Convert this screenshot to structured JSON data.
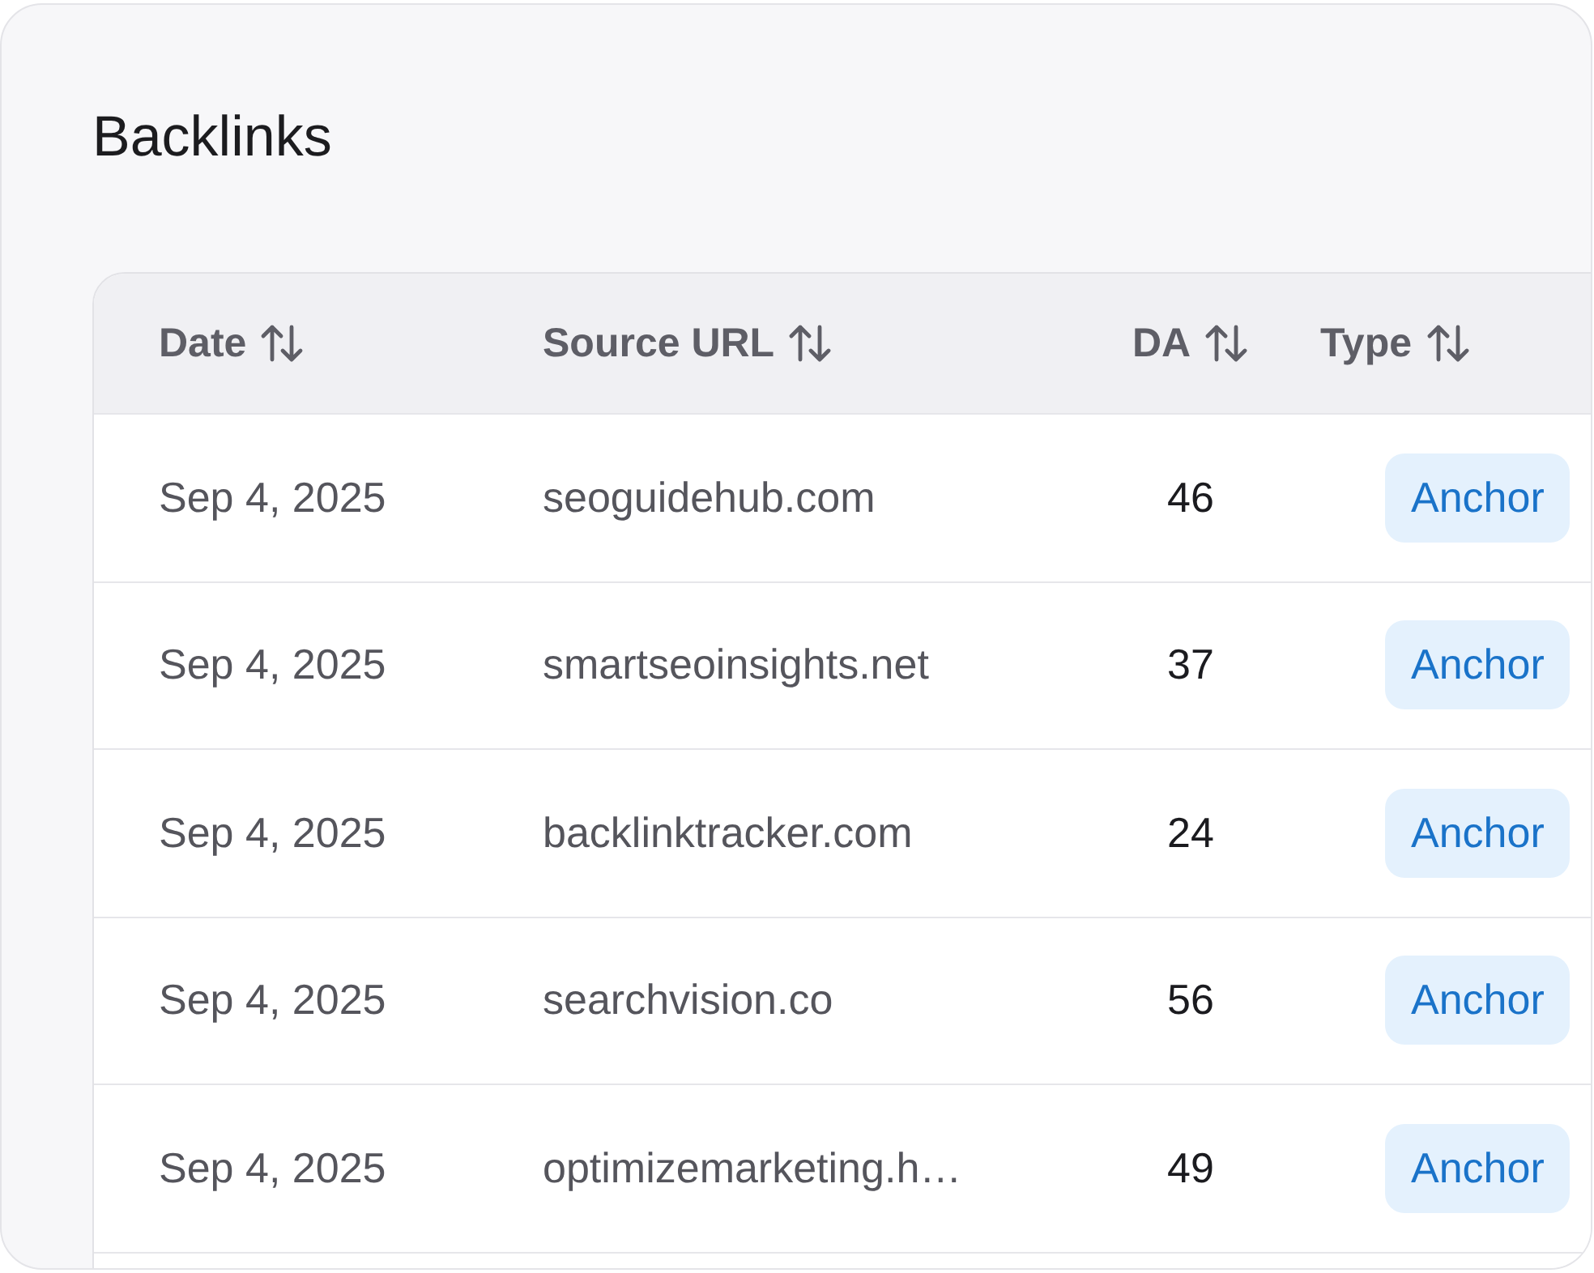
{
  "title": "Backlinks",
  "table": {
    "columns": [
      {
        "label": "Date",
        "sortable": true
      },
      {
        "label": "Source URL",
        "sortable": true
      },
      {
        "label": "DA",
        "sortable": true
      },
      {
        "label": "Type",
        "sortable": true
      }
    ],
    "rows": [
      {
        "date": "Sep 4, 2025",
        "source_url": "seoguidehub.com",
        "da": "46",
        "type": "Anchor"
      },
      {
        "date": "Sep 4, 2025",
        "source_url": "smartseoinsights.net",
        "da": "37",
        "type": "Anchor"
      },
      {
        "date": "Sep 4, 2025",
        "source_url": "backlinktracker.com",
        "da": "24",
        "type": "Anchor"
      },
      {
        "date": "Sep 4, 2025",
        "source_url": "searchvision.co",
        "da": "56",
        "type": "Anchor"
      },
      {
        "date": "Sep 4, 2025",
        "source_url": "optimizemarketing.h…",
        "da": "49",
        "type": "Anchor"
      }
    ]
  }
}
